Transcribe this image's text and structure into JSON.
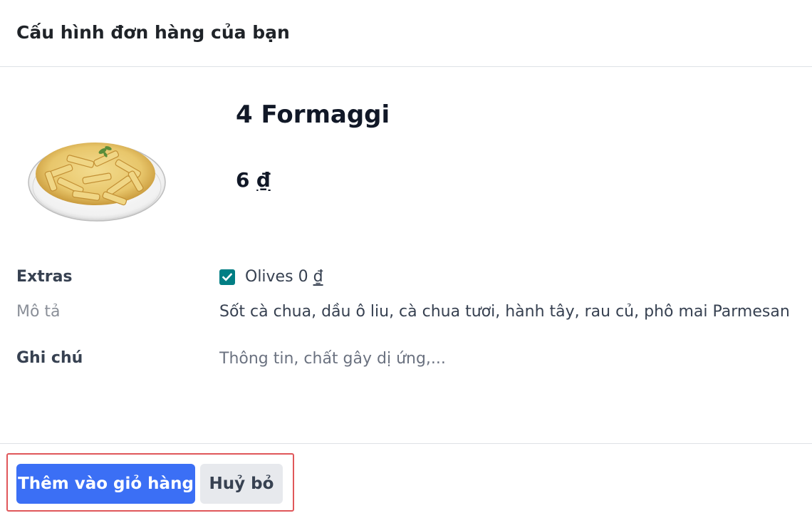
{
  "dialog": {
    "title": "Cấu hình đơn hàng của bạn"
  },
  "product": {
    "name": "4 Formaggi",
    "price_amount": "6",
    "currency_symbol": "₫",
    "image_icon": "pasta-plate-image"
  },
  "extras": {
    "label": "Extras",
    "option": {
      "name": "Olives",
      "price_amount": "0",
      "currency_symbol": "₫",
      "checked": true
    }
  },
  "description": {
    "label": "Mô tả",
    "text": "Sốt cà chua, dầu ô liu, cà chua tươi, hành tây, rau củ, phô mai Parmesan"
  },
  "note": {
    "label": "Ghi chú",
    "placeholder": "Thông tin, chất gây dị ứng,...",
    "value": ""
  },
  "footer": {
    "add_to_cart_label": "Thêm vào giỏ hàng",
    "cancel_label": "Huỷ bỏ"
  },
  "colors": {
    "primary_button": "#3b6ff5",
    "checkbox": "#017e84",
    "highlight_border": "#e0575a"
  }
}
